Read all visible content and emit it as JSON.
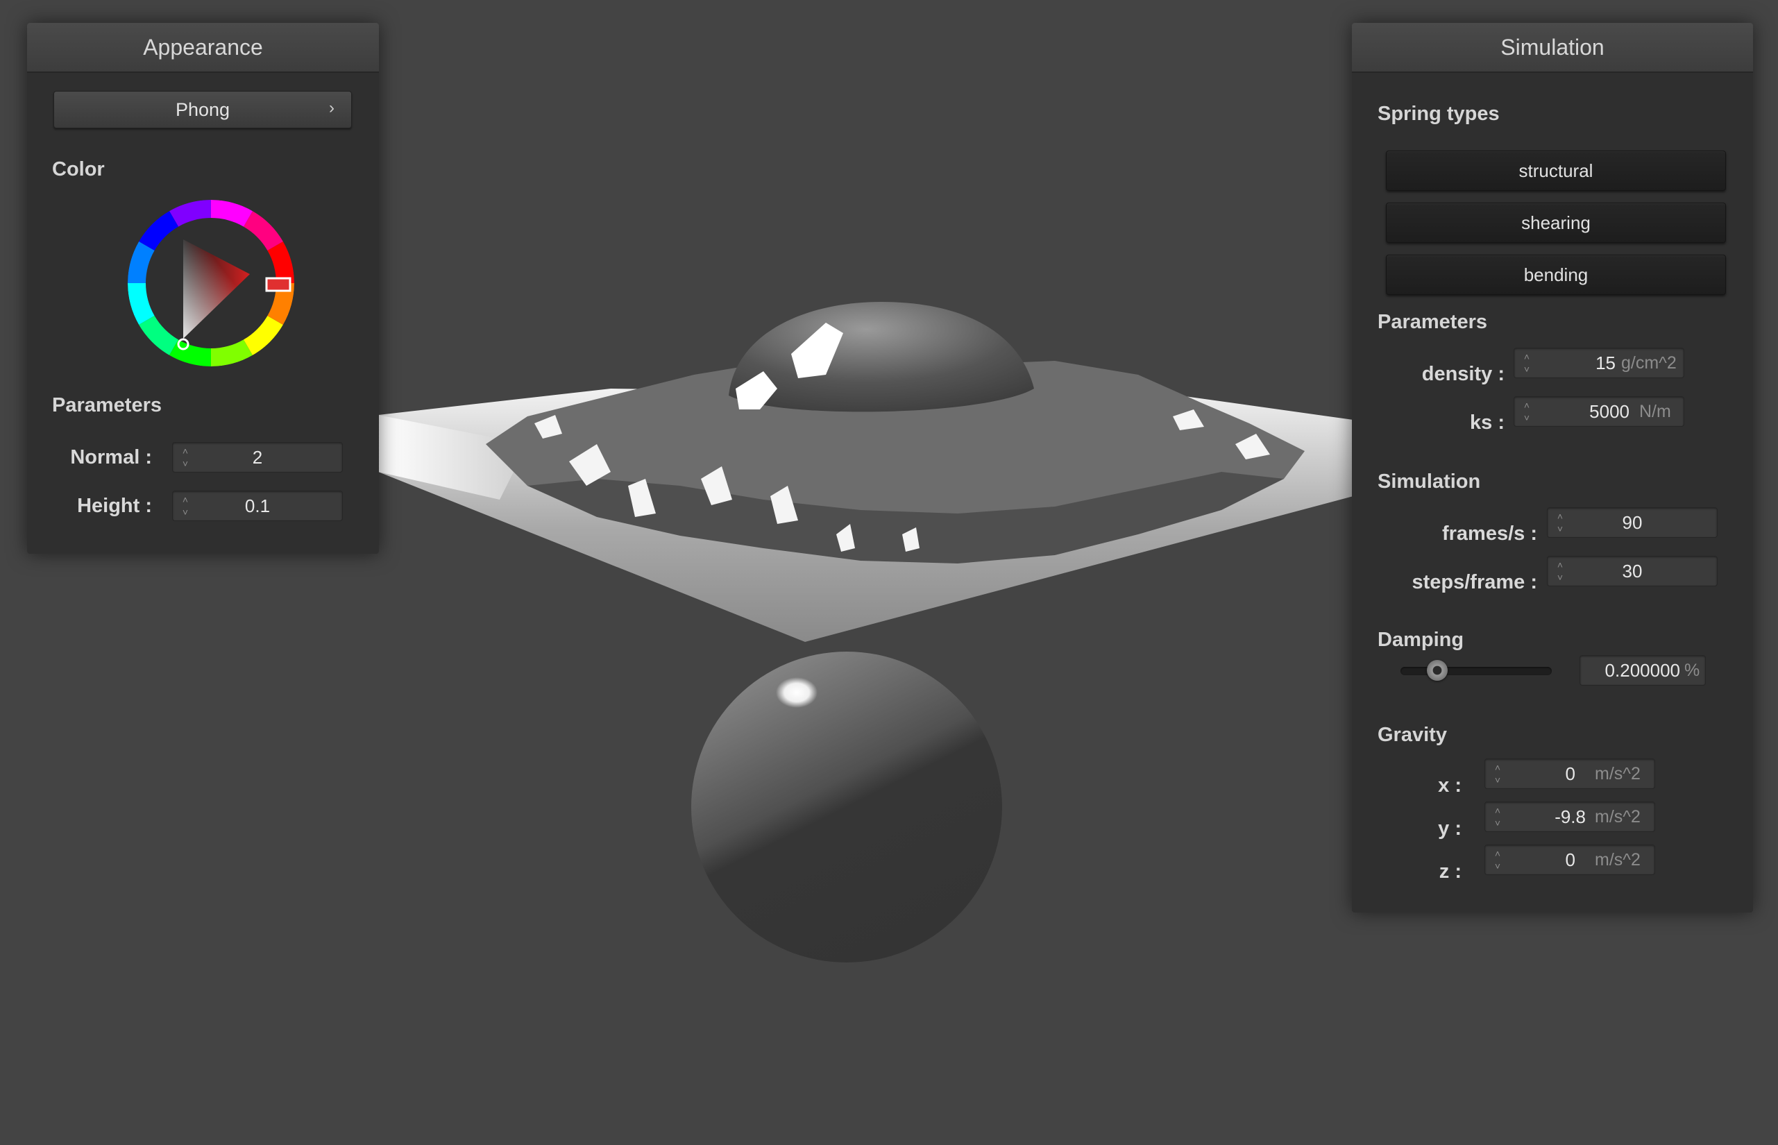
{
  "appearance": {
    "title": "Appearance",
    "shader_select": "Phong",
    "color_label": "Color",
    "selected_color": "#b32020",
    "parameters_label": "Parameters",
    "normal_label": "Normal :",
    "normal_value": "2",
    "height_label": "Height :",
    "height_value": "0.1"
  },
  "simulation": {
    "title": "Simulation",
    "spring_types_label": "Spring types",
    "spring_buttons": [
      "structural",
      "shearing",
      "bending"
    ],
    "parameters_label": "Parameters",
    "density_label": "density :",
    "density_value": "15",
    "density_unit": "g/cm^2",
    "ks_label": "ks :",
    "ks_value": "5000",
    "ks_unit": "N/m",
    "sim_label": "Simulation",
    "fps_label": "frames/s :",
    "fps_value": "90",
    "steps_label": "steps/frame :",
    "steps_value": "30",
    "damping_label": "Damping",
    "damping_value": "0.200000",
    "damping_unit": "%",
    "damping_slider_fraction": 0.2,
    "gravity_label": "Gravity",
    "gx_label": "x :",
    "gx_value": "0",
    "gy_label": "y :",
    "gy_value": "-9.8",
    "gz_label": "z :",
    "gz_value": "0",
    "g_unit": "m/s^2"
  },
  "colors": {
    "background": "#444444",
    "panel": "#2f2f2f",
    "accent_red": "#e03030"
  }
}
